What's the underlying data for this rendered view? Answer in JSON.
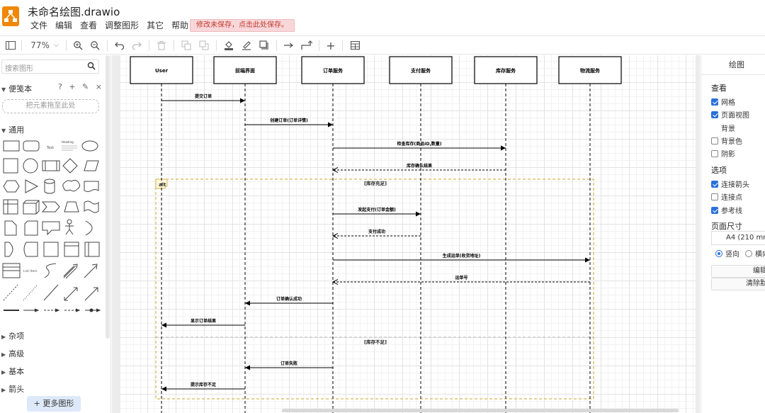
{
  "app": {
    "title": "未命名绘图.drawio",
    "menu": [
      "文件",
      "编辑",
      "查看",
      "调整图形",
      "其它",
      "帮助"
    ],
    "save_banner": "修改未保存，点击此处保存。"
  },
  "toolbar": {
    "zoom": "77%"
  },
  "sidebar": {
    "search_placeholder": "搜索图形",
    "scratchpad_label": "便笺本",
    "scratchpad_tools": "? + ✎ ×",
    "drop_zone": "把元素拖至此处",
    "general_label": "通用",
    "shape_text_label": "Text",
    "shape_heading_label": "Heading",
    "shape_list_label": "List Item",
    "collapsed_sections": [
      "杂项",
      "高级",
      "基本",
      "箭头"
    ],
    "more_shapes": "+ 更多图形"
  },
  "diagram": {
    "participants": [
      "User",
      "前端界面",
      "订单服务",
      "支付服务",
      "库存服务",
      "物流服务"
    ],
    "alt_label": "alt",
    "alt_conditions": [
      "[库存充足]",
      "[库存不足]"
    ],
    "messages": [
      {
        "from": 0,
        "to": 1,
        "label": "提交订单",
        "dashed": false
      },
      {
        "from": 1,
        "to": 2,
        "label": "创建订单(订单详情)",
        "dashed": false
      },
      {
        "from": 2,
        "to": 4,
        "label": "检查库存(商品ID,数量)",
        "dashed": false
      },
      {
        "from": 4,
        "to": 2,
        "label": "库存确认结果",
        "dashed": true
      },
      {
        "from": 2,
        "to": 3,
        "label": "发起支付(订单金额)",
        "dashed": false
      },
      {
        "from": 3,
        "to": 2,
        "label": "支付成功",
        "dashed": true
      },
      {
        "from": 2,
        "to": 5,
        "label": "生成运单(收货地址)",
        "dashed": false
      },
      {
        "from": 5,
        "to": 2,
        "label": "运单号",
        "dashed": true
      },
      {
        "from": 2,
        "to": 1,
        "label": "订单确认成功",
        "dashed": false
      },
      {
        "from": 1,
        "to": 0,
        "label": "显示订单结果",
        "dashed": false
      },
      {
        "from": 2,
        "to": 1,
        "label": "订单失败",
        "dashed": false
      },
      {
        "from": 1,
        "to": 0,
        "label": "提示库存不足",
        "dashed": false
      }
    ]
  },
  "format_panel": {
    "tab": "绘图",
    "view_heading": "查看",
    "grid": "网格",
    "page_view": "页面视图",
    "background": "背景",
    "background_color": "背景色",
    "shadow": "阴影",
    "options_heading": "选项",
    "connection_arrows": "连接箭头",
    "connection_points": "连接点",
    "guides": "参考线",
    "page_size_heading": "页面尺寸",
    "page_size_value": "A4 (210 mm",
    "portrait": "竖向",
    "landscape": "横向",
    "edit_button": "编辑",
    "clear_button": "清除默"
  },
  "colors": {
    "accent": "#f08705",
    "alt_frame": "#d6b656",
    "checkbox": "#2b6fdb",
    "banner_bg": "#f8d7da",
    "banner_text": "#c0392b"
  }
}
